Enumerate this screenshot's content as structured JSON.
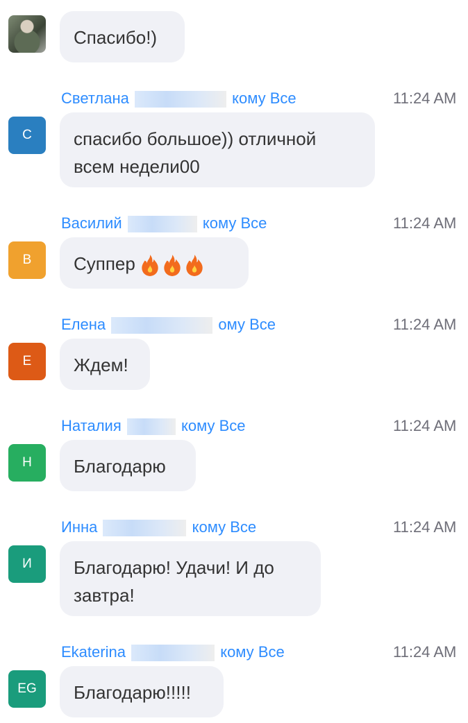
{
  "messages": [
    {
      "avatar_initials": "",
      "avatar_color": "#6b7a5e",
      "text": "Спасибо!)"
    },
    {
      "sender": "Светлана",
      "to_label": "кому",
      "recipient": "Все",
      "time": "11:24 AM",
      "avatar_initials": "С",
      "avatar_color": "#2a7fc0",
      "text": "спасибо большое)) отличной всем недели00"
    },
    {
      "sender": "Василий",
      "to_label": "кому",
      "recipient": "Все",
      "time": "11:24 AM",
      "avatar_initials": "В",
      "avatar_color": "#f0a12e",
      "text": "Суппер",
      "emoji": [
        "fire-icon",
        "fire-icon",
        "fire-icon"
      ]
    },
    {
      "sender": "Елена",
      "to_label": "ому",
      "recipient": "Все",
      "time": "11:24 AM",
      "avatar_initials": "Е",
      "avatar_color": "#dd5a16",
      "text": "Ждем!"
    },
    {
      "sender": "Наталия",
      "to_label": "кому",
      "recipient": "Все",
      "time": "11:24 AM",
      "avatar_initials": "Н",
      "avatar_color": "#27ae60",
      "text": "Благодарю"
    },
    {
      "sender": "Инна",
      "to_label": "кому",
      "recipient": "Все",
      "time": "11:24 AM",
      "avatar_initials": "И",
      "avatar_color": "#1a9c7c",
      "text": "Благодарю! Удачи! И до завтра!"
    },
    {
      "sender": "Ekaterina",
      "to_label": "кому",
      "recipient": "Все",
      "time": "11:24 AM",
      "avatar_initials": "EG",
      "avatar_color": "#1a9c7c",
      "text": "Благодарю!!!!!"
    }
  ]
}
